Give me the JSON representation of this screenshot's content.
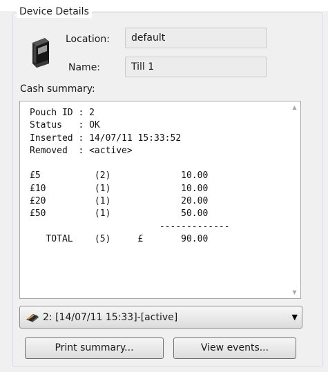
{
  "group_title": "Device Details",
  "location": {
    "label": "Location:",
    "value": "default"
  },
  "name": {
    "label": "Name:",
    "value": "Till 1"
  },
  "cash_summary": {
    "label": "Cash summary:",
    "text": "Pouch ID : 2\nStatus   : OK\nInserted : 14/07/11 15:33:52\nRemoved  : <active>\n\n£5          (2)             10.00\n£10         (1)             10.00\n£20         (1)             20.00\n£50         (1)             50.00\n                        -------------\n   TOTAL    (5)     £       90.00"
  },
  "pouch_select": {
    "value": "2: [14/07/11 15:33]-[active]"
  },
  "buttons": {
    "print_summary": "Print summary...",
    "view_events": "View events..."
  },
  "icons": {
    "device": "device-terminal-icon",
    "pouch": "pouch-icon",
    "scroll_up": "scroll-up-arrow-icon",
    "scroll_down": "scroll-down-arrow-icon",
    "dropdown": "dropdown-arrow-icon"
  },
  "colors": {
    "panel_background": "#f0f0f0",
    "groupbox_border": "#d5dfe5",
    "readonly_field": "#ececec"
  }
}
